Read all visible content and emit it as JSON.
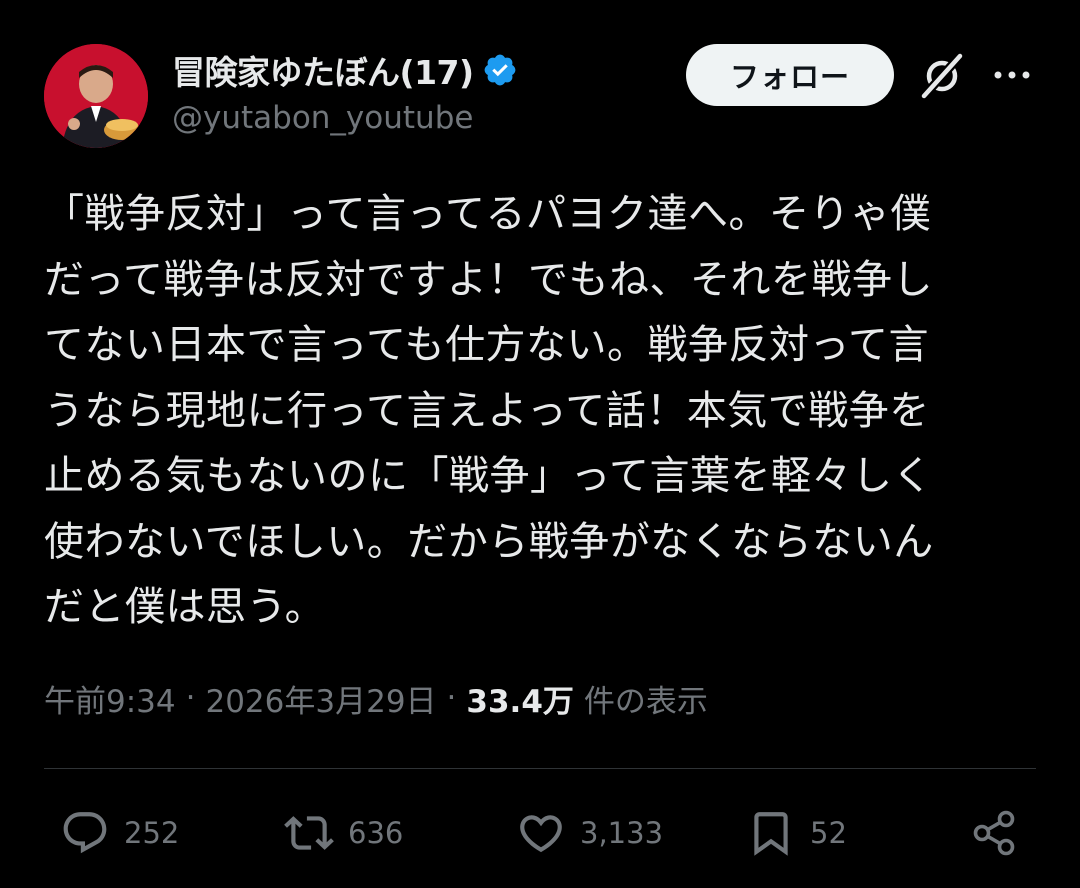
{
  "header": {
    "display_name": "冒険家ゆたぼん(17)",
    "handle": "@yutabon_youtube",
    "follow_label": "フォロー",
    "verified_icon": "verified-badge-icon",
    "accent_color": "#1d9bf0"
  },
  "post": {
    "lines": [
      "「戦争反対」って言ってるパヨク達へ。そりゃ僕",
      "だって戦争は反対ですよ！でもね、それを戦争し",
      "てない日本で言っても仕方ない。戦争反対って言",
      "うなら現地に行って言えよって話！本気で戦争を",
      "止める気もないのに「戦争」って言葉を軽々しく",
      "使わないでほしい。だから戦争がなくならないん",
      "だと僕は思う。"
    ],
    "time": "午前9:34",
    "date": "2026年3月29日",
    "views_count": "33.4万",
    "views_label": "件の表示",
    "separator": "·"
  },
  "actions": {
    "replies": "252",
    "reposts": "636",
    "likes": "3,133",
    "bookmarks": "52"
  }
}
